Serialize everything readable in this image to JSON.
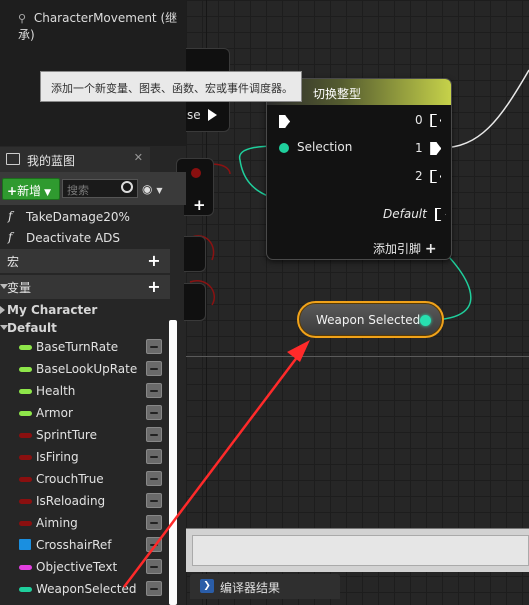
{
  "top_panel": {
    "component_label": "CharacterMovement (继承)"
  },
  "tooltip": {
    "text": "添加一个新变量、图表、函数、宏或事件调度器。"
  },
  "graph": {
    "stub_node_label": "se",
    "switch_node": {
      "title": "切换整型",
      "selection_label": "Selection",
      "outputs": [
        "0",
        "1",
        "2"
      ],
      "default_label": "Default",
      "add_pin_label": "添加引脚"
    },
    "weapon_node": {
      "label": "Weapon Selected"
    }
  },
  "bottom": {
    "compiler_tab": "编译器结果"
  },
  "my_blueprint": {
    "tab_label": "我的蓝图",
    "new_button": "新增",
    "search_placeholder": "搜索",
    "functions": [
      "TakeDamage20%",
      "Deactivate ADS"
    ],
    "sections": {
      "macros": "宏",
      "variables": "变量"
    },
    "categories": {
      "my_character": "My Character",
      "default": "Default"
    },
    "variables": [
      {
        "name": "BaseTurnRate",
        "color": "#8ee64a"
      },
      {
        "name": "BaseLookUpRate",
        "color": "#8ee64a"
      },
      {
        "name": "Health",
        "color": "#8ee64a"
      },
      {
        "name": "Armor",
        "color": "#8ee64a"
      },
      {
        "name": "SprintTure",
        "color": "#8a0f0f"
      },
      {
        "name": "IsFiring",
        "color": "#8a0f0f"
      },
      {
        "name": "CrouchTrue",
        "color": "#8a0f0f"
      },
      {
        "name": "IsReloading",
        "color": "#8a0f0f"
      },
      {
        "name": "Aiming",
        "color": "#8a0f0f"
      },
      {
        "name": "CrosshairRef",
        "color": "#1a8fe0"
      },
      {
        "name": "ObjectiveText",
        "color": "#e23fe0"
      },
      {
        "name": "WeaponSelected",
        "color": "#1fcf9c"
      }
    ]
  },
  "colors": {
    "accent_orange": "#f0a21a",
    "wire_teal": "#1fcf9c",
    "arrow_red": "#ff2a2a"
  }
}
